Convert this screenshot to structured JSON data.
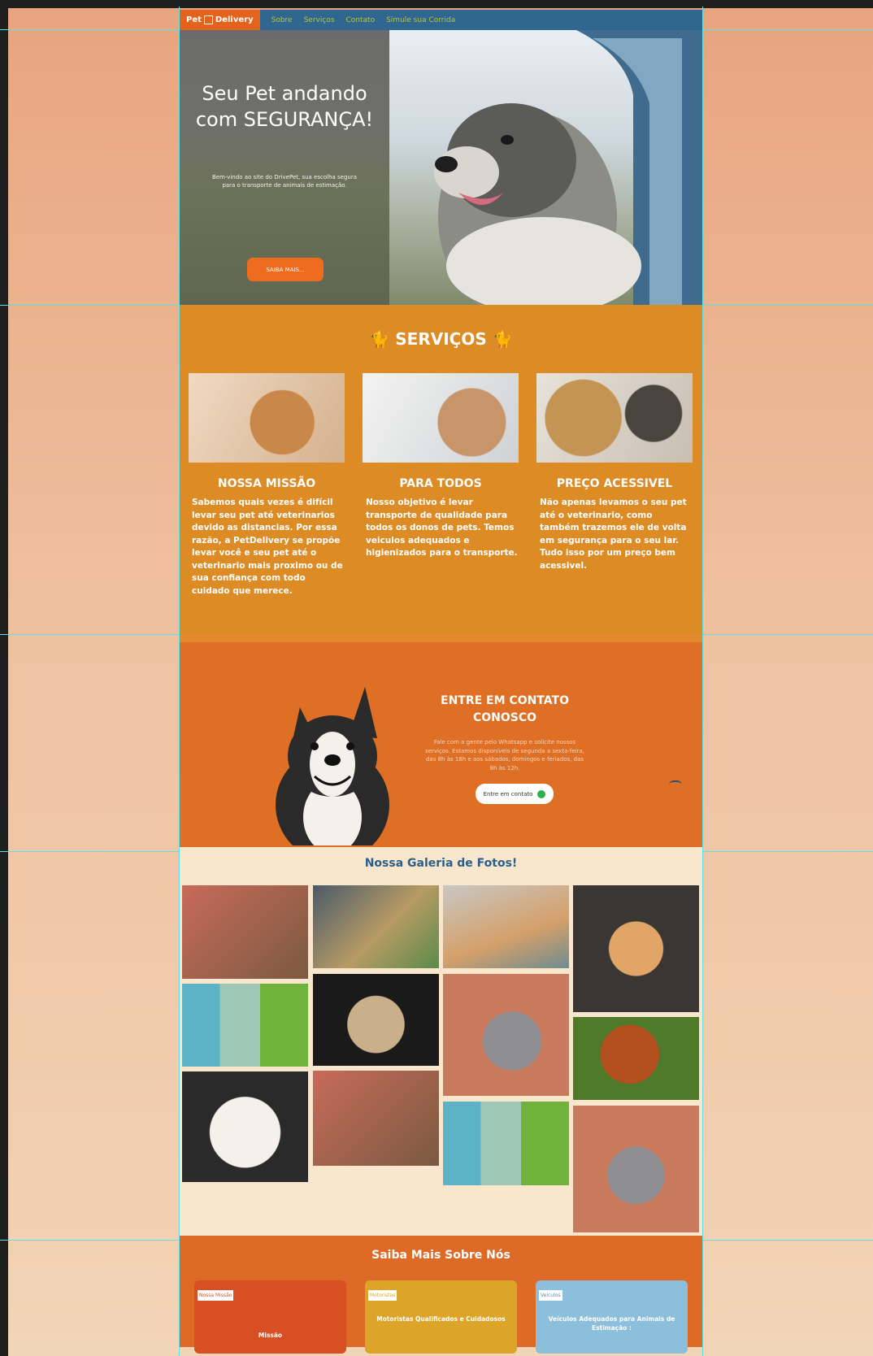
{
  "nav": {
    "brand_prefix": "Pet",
    "brand_suffix": "Delivery",
    "links": [
      "Sobre",
      "Serviços",
      "Contato",
      "Simule sua Corrida"
    ]
  },
  "hero": {
    "title": "Seu Pet andando com SEGURANÇA!",
    "subtitle": "Bem-vindo ao site do DrivePet, sua escolha segura para o transporte de animais de estimação.",
    "button": "SAIBA MAIS..."
  },
  "services": {
    "title": "SERVIÇOS",
    "items": [
      {
        "heading": "NOSSA MISSÃO",
        "text": "Sabemos quais vezes é difícil levar seu pet até veterinarios devido as distancias. Por essa razão, a PetDelivery se propõe levar você e seu pet até o veterinario mais proximo ou de sua confiança com todo cuidado que merece."
      },
      {
        "heading": "PARA TODOS",
        "text": "Nosso objetivo é levar transporte de qualidade para todos os donos de pets. Temos veiculos adequados e higienizados para o transporte."
      },
      {
        "heading": "PREÇO ACESSIVEL",
        "text": "Não apenas levamos o seu pet até o veterinario, como também trazemos ele de volta em segurança para o seu lar. Tudo isso por um preço bem acessivel."
      }
    ]
  },
  "contact": {
    "title": "ENTRE EM CONTATO CONOSCO",
    "text": "Fale com a gente pelo Whatsapp e solicite nossos serviços. Estamos disponíveis de segunda a sexta-feira, das 8h às 18h e aos sábados, domingos e feriados, das 8h às 12h.",
    "button": "Entre em contato"
  },
  "gallery": {
    "title": "Nossa Galeria de Fotos!"
  },
  "about": {
    "title": "Saiba Mais Sobre Nós",
    "cards": [
      {
        "tag": "Nossa Missão",
        "text": "Missão",
        "color": "#d94f24"
      },
      {
        "tag": "Motoristas",
        "text": "Motoristas Qualificados e Cuidadosos",
        "color": "#dca52a"
      },
      {
        "tag": "Veículos",
        "text": "Veículos Adequados para Animais de Estimação :",
        "color": "#8cbfdc"
      }
    ]
  },
  "colors": {
    "nav": "#2f6790",
    "accent_orange": "#e3621c",
    "services_bg": "#dc8b25",
    "gallery_title": "#2b5f8a"
  }
}
